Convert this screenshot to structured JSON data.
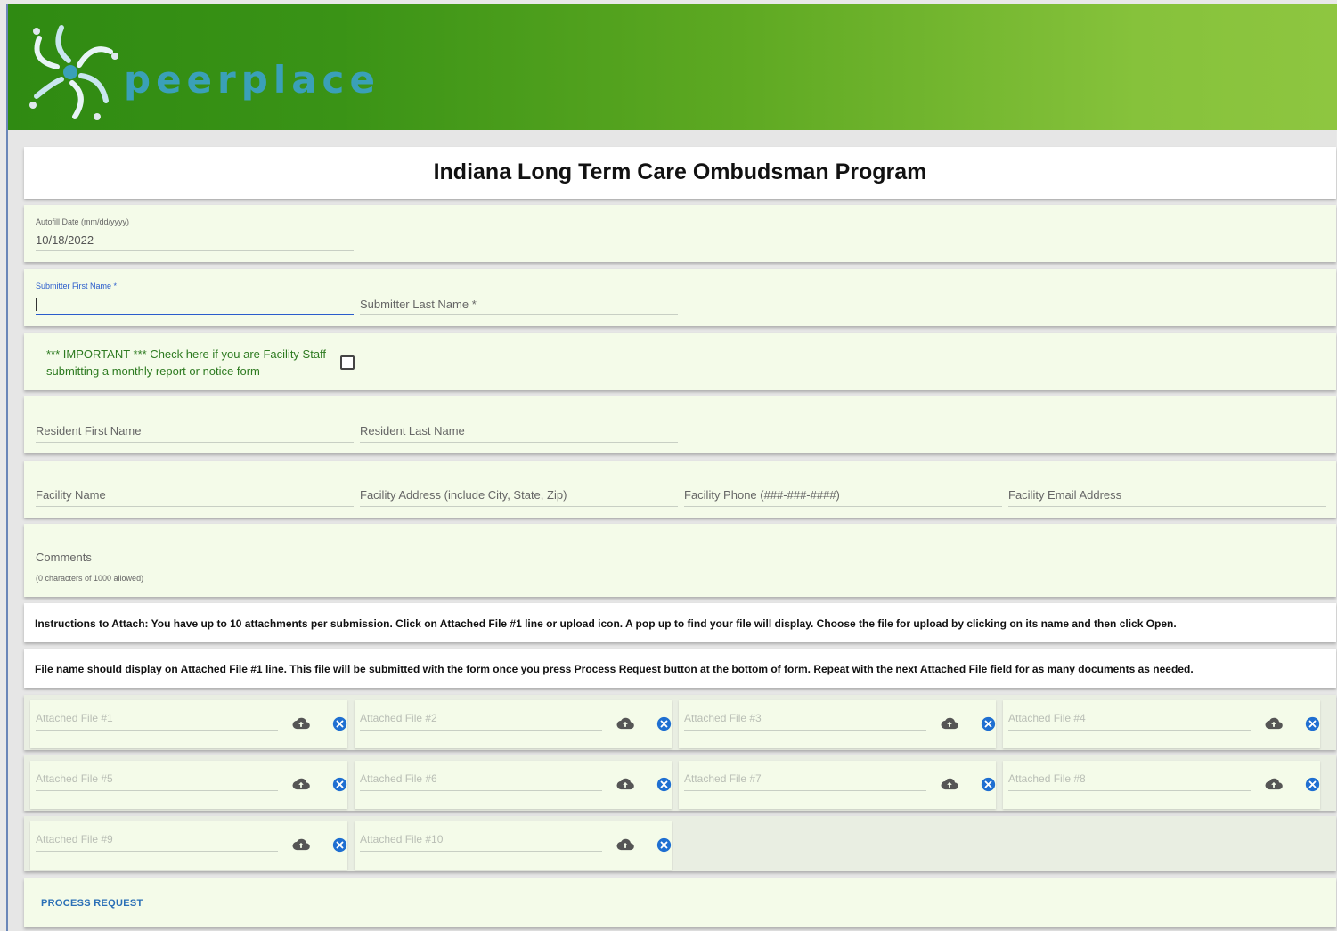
{
  "header": {
    "logo_text": "peerplace",
    "colors": {
      "green_dark": "#2f8a12",
      "green_light": "#8ec640",
      "logo_teal": "#3aa0b8"
    }
  },
  "title": "Indiana Long Term Care Ombudsman Program",
  "autofill": {
    "label": "Autofill Date (mm/dd/yyyy)",
    "value": "10/18/2022"
  },
  "submitter": {
    "first_label": "Submitter First Name *",
    "last_placeholder": "Submitter Last Name *"
  },
  "important": {
    "line1": "*** IMPORTANT *** Check here if you are Facility Staff",
    "line2": "submitting a monthly report or notice form"
  },
  "resident": {
    "first": "Resident First Name",
    "last": "Resident Last Name"
  },
  "facility": {
    "name": "Facility Name",
    "address": "Facility Address (include City, State, Zip)",
    "phone": "Facility Phone (###-###-####)",
    "email": "Facility Email Address"
  },
  "comments": {
    "label": "Comments",
    "counter": "(0 characters of 1000 allowed)"
  },
  "instructions": {
    "line1": "Instructions to Attach: You have up to 10 attachments per submission. Click on Attached File #1 line or upload icon. A pop up to find your file will display. Choose the file for upload by clicking on its name and then click Open.",
    "line2": "File name should display on Attached File #1 line. This file will be submitted with the form once you press Process Request button at the bottom of form. Repeat with the next Attached File field for as many documents as needed."
  },
  "attachments": [
    "Attached File #1",
    "Attached File #2",
    "Attached File #3",
    "Attached File #4",
    "Attached File #5",
    "Attached File #6",
    "Attached File #7",
    "Attached File #8",
    "Attached File #9",
    "Attached File #10"
  ],
  "icons": {
    "upload": "cloud-upload-icon",
    "clear": "clear-circle-icon"
  },
  "process_button": "PROCESS REQUEST"
}
